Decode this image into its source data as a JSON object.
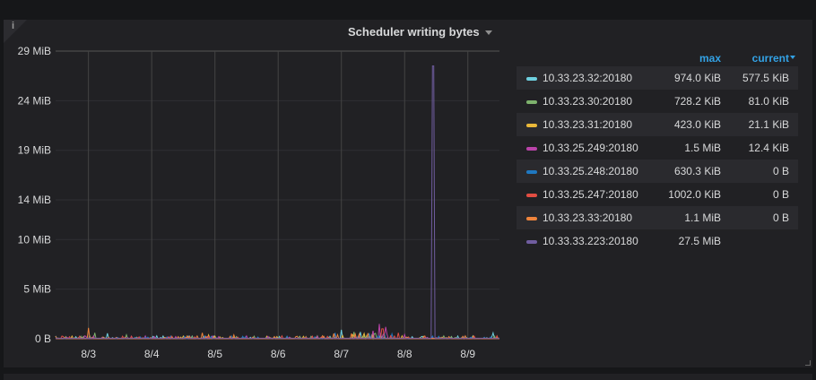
{
  "panel": {
    "title": "Scheduler writing bytes",
    "info_icon": "i"
  },
  "legend": {
    "headers": {
      "max": "max",
      "current": "current"
    },
    "rows": [
      {
        "name": "10.33.23.32:20180",
        "max": "974.0 KiB",
        "current": "577.5 KiB",
        "color": "#6ed0e0"
      },
      {
        "name": "10.33.23.30:20180",
        "max": "728.2 KiB",
        "current": "81.0 KiB",
        "color": "#7eb26d"
      },
      {
        "name": "10.33.23.31:20180",
        "max": "423.0 KiB",
        "current": "21.1 KiB",
        "color": "#eab839"
      },
      {
        "name": "10.33.25.249:20180",
        "max": "1.5 MiB",
        "current": "12.4 KiB",
        "color": "#ba43a9"
      },
      {
        "name": "10.33.25.248:20180",
        "max": "630.3 KiB",
        "current": "0 B",
        "color": "#1f78c1"
      },
      {
        "name": "10.33.25.247:20180",
        "max": "1002.0 KiB",
        "current": "0 B",
        "color": "#e24d42"
      },
      {
        "name": "10.33.23.33:20180",
        "max": "1.1 MiB",
        "current": "0 B",
        "color": "#ef843c"
      },
      {
        "name": "10.33.33.223:20180",
        "max": "27.5 MiB",
        "current": "",
        "color": "#705da0"
      }
    ]
  },
  "chart_data": {
    "type": "line",
    "title": "Scheduler writing bytes",
    "xlabel": "",
    "ylabel": "",
    "x_unit": "day of August",
    "xlim": [
      2.48,
      9.5
    ],
    "ylim": [
      0,
      29
    ],
    "y_unit": "MiB",
    "x_ticks": [
      {
        "v": 3,
        "label": "8/3"
      },
      {
        "v": 4,
        "label": "8/4"
      },
      {
        "v": 5,
        "label": "8/5"
      },
      {
        "v": 6,
        "label": "8/6"
      },
      {
        "v": 7,
        "label": "8/7"
      },
      {
        "v": 8,
        "label": "8/8"
      },
      {
        "v": 9,
        "label": "8/9"
      }
    ],
    "y_ticks": [
      {
        "v": 0,
        "label": "0 B"
      },
      {
        "v": 5,
        "label": "5 MiB"
      },
      {
        "v": 10,
        "label": "10 MiB"
      },
      {
        "v": 14,
        "label": "14 MiB"
      },
      {
        "v": 19,
        "label": "19 MiB"
      },
      {
        "v": 24,
        "label": "24 MiB"
      },
      {
        "v": 29,
        "label": "29 MiB"
      }
    ],
    "grid": true,
    "legend_position": "right",
    "series": [
      {
        "name": "10.33.23.32:20180",
        "peaks": [
          [
            3.3,
            0.55
          ],
          [
            7.0,
            0.9
          ],
          [
            7.3,
            0.7
          ],
          [
            9.4,
            0.6
          ]
        ]
      },
      {
        "name": "10.33.23.30:20180",
        "peaks": [
          [
            3.1,
            0.6
          ],
          [
            3.6,
            0.4
          ],
          [
            7.2,
            0.7
          ]
        ]
      },
      {
        "name": "10.33.23.31:20180",
        "peaks": [
          [
            4.9,
            0.4
          ],
          [
            7.5,
            0.4
          ]
        ]
      },
      {
        "name": "10.33.25.249:20180",
        "peaks": [
          [
            7.6,
            1.5
          ],
          [
            7.7,
            1.2
          ],
          [
            7.5,
            0.8
          ]
        ]
      },
      {
        "name": "10.33.25.248:20180",
        "peaks": [
          [
            6.9,
            0.6
          ],
          [
            7.8,
            0.5
          ]
        ]
      },
      {
        "name": "10.33.25.247:20180",
        "peaks": [
          [
            7.65,
            1.0
          ],
          [
            7.9,
            0.6
          ]
        ]
      },
      {
        "name": "10.33.23.33:20180",
        "peaks": [
          [
            3.0,
            1.1
          ],
          [
            4.8,
            0.6
          ],
          [
            5.3,
            0.4
          ]
        ]
      },
      {
        "name": "10.33.33.223:20180",
        "peaks": [
          [
            8.45,
            27.5
          ]
        ]
      }
    ]
  }
}
